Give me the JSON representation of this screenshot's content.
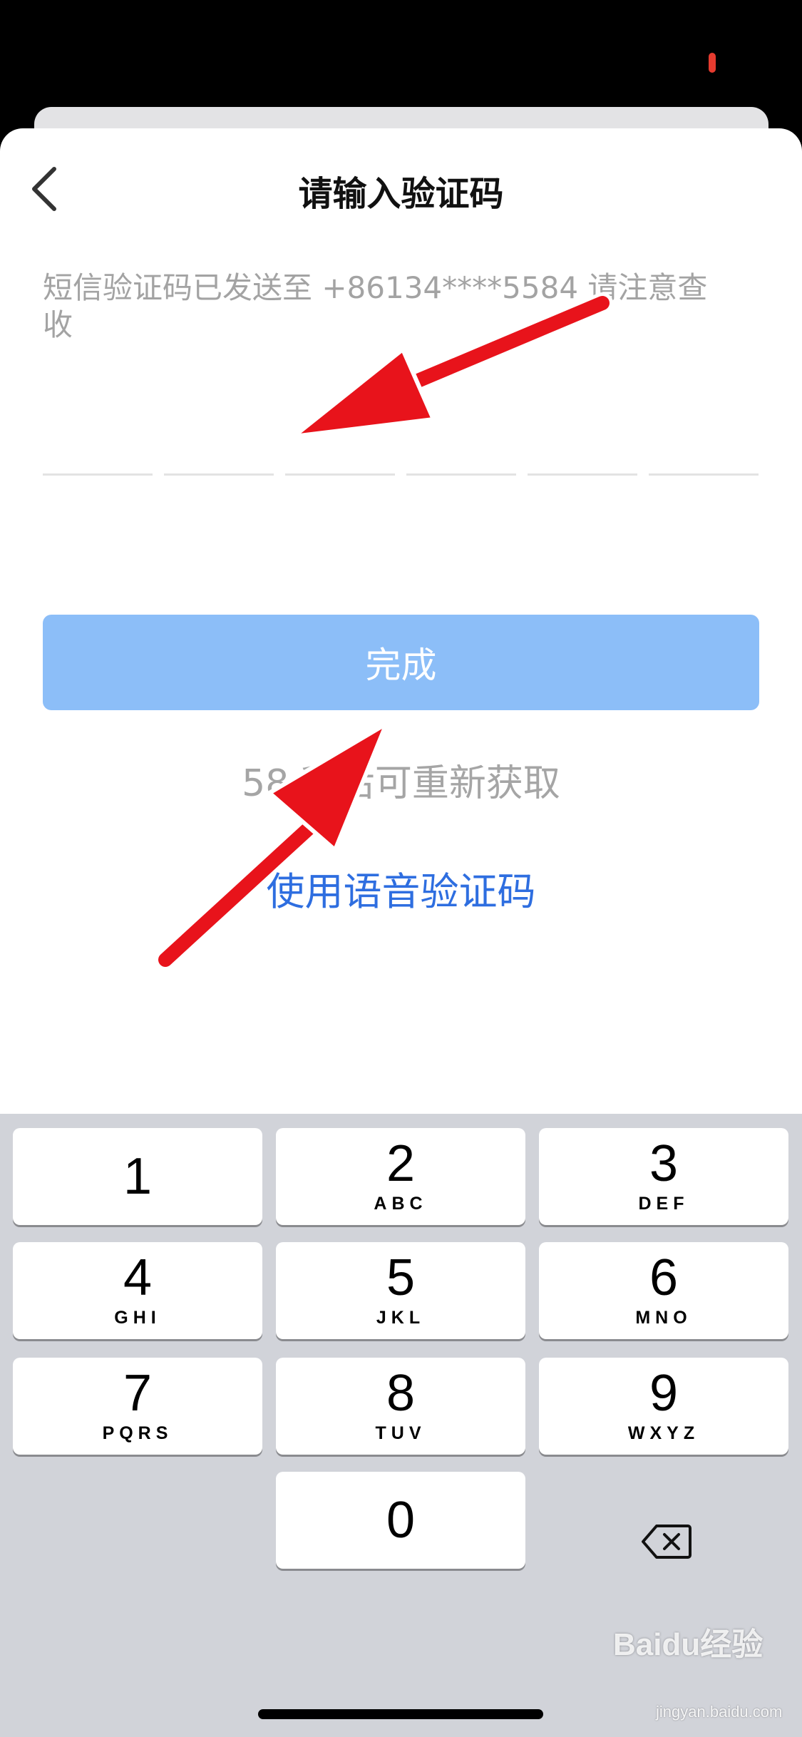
{
  "header": {
    "title": "请输入验证码"
  },
  "message": {
    "text": "短信验证码已发送至 +86134****5584 请注意查收"
  },
  "code_input": {
    "length": 6
  },
  "actions": {
    "done_label": "完成",
    "countdown_text": "58 秒后可重新获取",
    "voice_code_link": "使用语音验证码"
  },
  "keypad": {
    "keys": [
      {
        "digit": "1",
        "letters": ""
      },
      {
        "digit": "2",
        "letters": "ABC"
      },
      {
        "digit": "3",
        "letters": "DEF"
      },
      {
        "digit": "4",
        "letters": "GHI"
      },
      {
        "digit": "5",
        "letters": "JKL"
      },
      {
        "digit": "6",
        "letters": "MNO"
      },
      {
        "digit": "7",
        "letters": "PQRS"
      },
      {
        "digit": "8",
        "letters": "TUV"
      },
      {
        "digit": "9",
        "letters": "WXYZ"
      },
      {
        "digit": "0",
        "letters": ""
      }
    ],
    "delete_icon": "backspace-icon"
  },
  "watermark": {
    "brand": "Baidu经验",
    "url": "jingyan.baidu.com"
  },
  "colors": {
    "accent_button": "#8cbef8",
    "link": "#2e6ee0",
    "annotation_arrow": "#e8131b",
    "keyboard_bg": "#d1d3d9"
  }
}
